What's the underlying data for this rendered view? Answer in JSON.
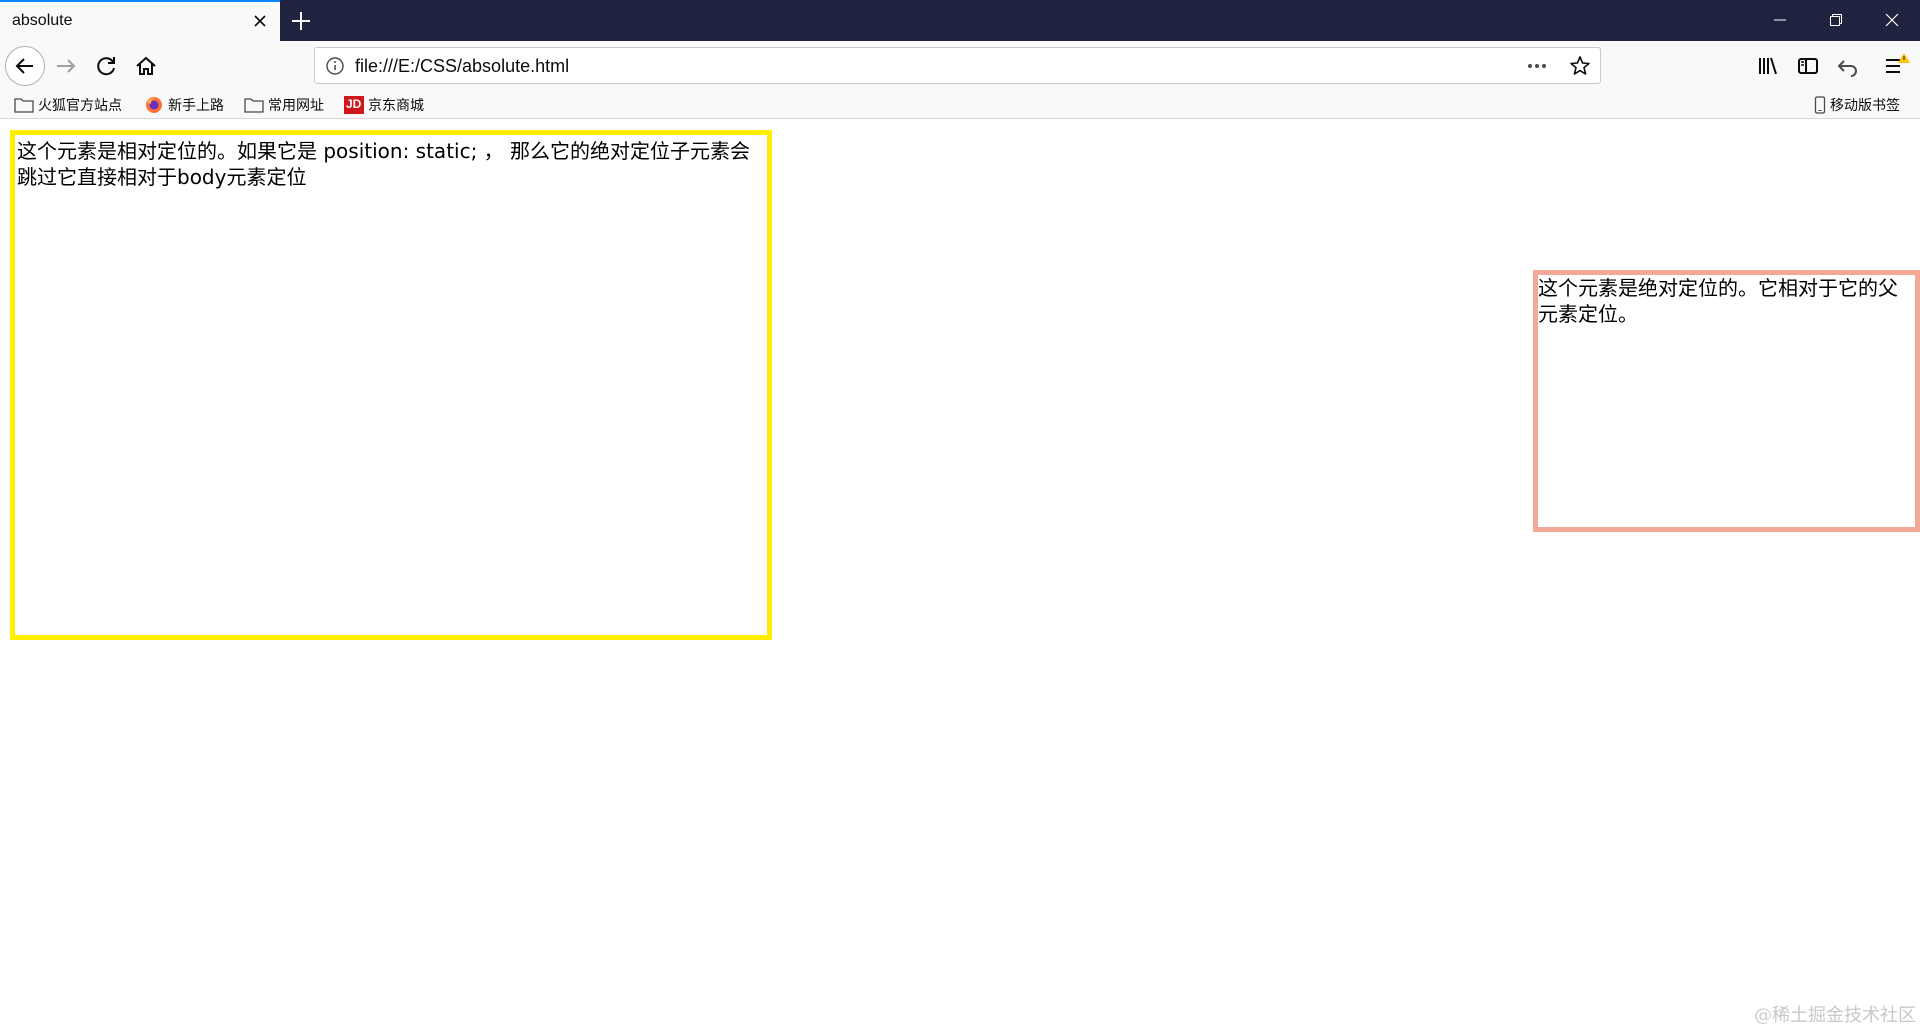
{
  "tab": {
    "title": "absolute"
  },
  "url": {
    "value": "file:///E:/CSS/absolute.html"
  },
  "bookmarks": [
    {
      "label": "火狐官方站点",
      "icon": "folder-icon"
    },
    {
      "label": "新手上路",
      "icon": "firefox-icon"
    },
    {
      "label": "常用网址",
      "icon": "folder-icon"
    },
    {
      "label": "京东商城",
      "icon": "jd-icon",
      "badge": "JD"
    }
  ],
  "mobile_bookmarks": {
    "label": "移动版书签",
    "icon": "phone-icon"
  },
  "page": {
    "relative_text": "这个元素是相对定位的。如果它是 position: static; ， 那么它的绝对定位子元素会跳过它直接相对于body元素定位",
    "absolute_text": "这个元素是绝对定位的。它相对于它的父元素定位。"
  },
  "watermark": "@稀土掘金技术社区",
  "colors": {
    "relative_border": "#ffee00",
    "absolute_border": "#f4a996",
    "tabbar_bg": "#202340",
    "tab_accent": "#0a84ff"
  }
}
